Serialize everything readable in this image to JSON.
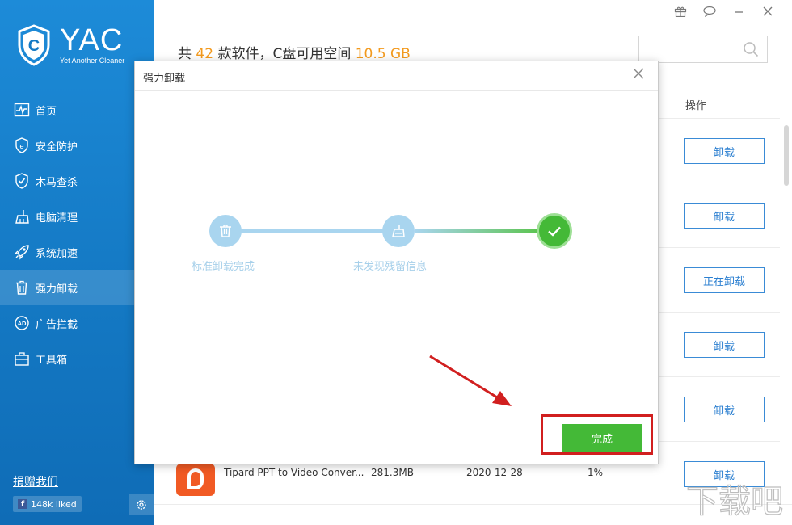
{
  "app": {
    "logo_text": "YAC",
    "logo_subtitle": "Yet Another Cleaner"
  },
  "sidebar": {
    "items": [
      {
        "label": "首页",
        "icon": "heartbeat-icon"
      },
      {
        "label": "安全防护",
        "icon": "shield-e-icon"
      },
      {
        "label": "木马查杀",
        "icon": "shield-check-icon"
      },
      {
        "label": "电脑清理",
        "icon": "broom-icon"
      },
      {
        "label": "系统加速",
        "icon": "rocket-icon"
      },
      {
        "label": "强力卸载",
        "icon": "trash-icon",
        "active": true
      },
      {
        "label": "广告拦截",
        "icon": "ad-block-icon"
      },
      {
        "label": "工具箱",
        "icon": "toolbox-icon"
      }
    ],
    "donate_label": "捐赠我们",
    "facebook_likes": "148k liked"
  },
  "header": {
    "prefix": "共 ",
    "count": "42",
    "middle": " 款软件，C盘可用空间 ",
    "space": "10.5 GB",
    "search_placeholder": ""
  },
  "table": {
    "op_header": "操作",
    "buttons": [
      "卸载",
      "卸载",
      "正在卸载",
      "卸载",
      "卸载",
      "卸载"
    ],
    "last_row": {
      "name": "Tipard PPT to Video Conver...",
      "size": "281.3MB",
      "date": "2020-12-28",
      "percent": "1%"
    }
  },
  "dialog": {
    "title": "强力卸载",
    "steps": [
      {
        "label": "标准卸载完成",
        "icon": "trash-icon"
      },
      {
        "label": "未发现残留信息",
        "icon": "broom-icon"
      },
      {
        "label": "",
        "icon": "check-icon"
      }
    ],
    "done_label": "完成"
  },
  "colors": {
    "sidebar": "#1479c4",
    "accent_orange": "#f39a1e",
    "done_green": "#44b937",
    "step_light": "#a9d5ef",
    "highlight_red": "#d11f1f"
  },
  "watermark": "下载吧"
}
